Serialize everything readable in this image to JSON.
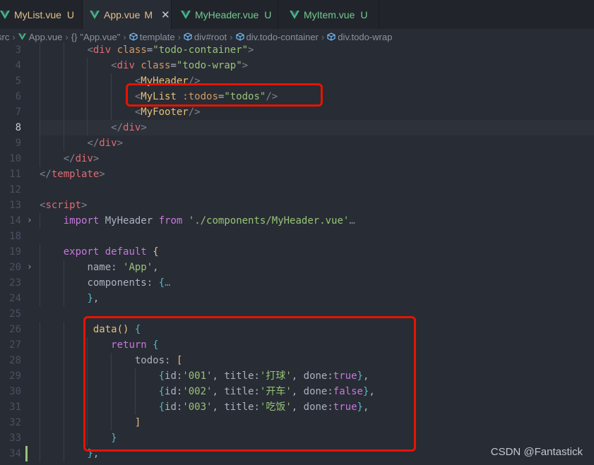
{
  "tabs": [
    {
      "name": "MyList.vue",
      "status": "U",
      "active": false
    },
    {
      "name": "App.vue",
      "status": "M",
      "active": true,
      "close": "✕"
    },
    {
      "name": "MyHeader.vue",
      "status": "U",
      "active": false
    },
    {
      "name": "MyItem.vue",
      "status": "U",
      "active": false
    }
  ],
  "breadcrumb": {
    "src": "src",
    "file": "App.vue",
    "braces": "{}",
    "module": "\"App.vue\"",
    "template": "template",
    "root": "div#root",
    "container": "div.todo-container",
    "wrap": "div.todo-wrap"
  },
  "lines": [
    {
      "n": "3",
      "code": "        <div class=\"todo-container\">"
    },
    {
      "n": "4",
      "code": "            <div class=\"todo-wrap\">"
    },
    {
      "n": "5",
      "code": "                <MyHeader/>"
    },
    {
      "n": "6",
      "code": "                <MyList :todos=\"todos\"/>"
    },
    {
      "n": "7",
      "code": "                <MyFooter/>"
    },
    {
      "n": "8",
      "code": "            </div>"
    },
    {
      "n": "9",
      "code": "        </div>"
    },
    {
      "n": "10",
      "code": "    </div>"
    },
    {
      "n": "11",
      "code": "</template>"
    },
    {
      "n": "12",
      "code": ""
    },
    {
      "n": "13",
      "code": "<script>"
    },
    {
      "n": "14",
      "code": "    import MyHeader from './components/MyHeader.vue'…"
    },
    {
      "n": "18",
      "code": ""
    },
    {
      "n": "19",
      "code": "    export default {"
    },
    {
      "n": "20",
      "code": "        name: 'App',"
    },
    {
      "n": "23",
      "code": "        components: {…"
    },
    {
      "n": "24",
      "code": "        },"
    },
    {
      "n": "25",
      "code": ""
    },
    {
      "n": "26",
      "code": "         data() {"
    },
    {
      "n": "27",
      "code": "            return {"
    },
    {
      "n": "28",
      "code": "                todos: ["
    },
    {
      "n": "29",
      "code": "                    {id:'001', title:'打球', done:true},"
    },
    {
      "n": "30",
      "code": "                    {id:'002', title:'开车', done:false},"
    },
    {
      "n": "31",
      "code": "                    {id:'003', title:'吃饭', done:true},"
    },
    {
      "n": "32",
      "code": "                ]"
    },
    {
      "n": "33",
      "code": "            }"
    },
    {
      "n": "34",
      "code": "        },"
    }
  ],
  "current_line": "8",
  "watermark": "CSDN @Fantastick",
  "colors": {
    "background": "#282c34",
    "highlight_box": "#e51400",
    "modified_gutter": "#98c379"
  }
}
